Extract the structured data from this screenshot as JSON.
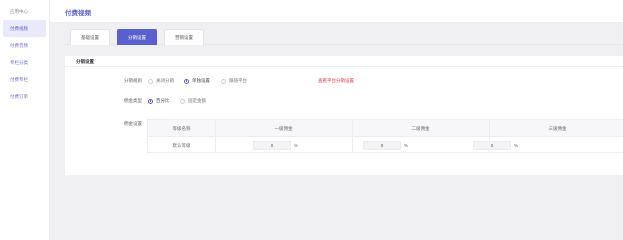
{
  "sidebar": {
    "items": [
      {
        "label": "应用中心",
        "active": false
      },
      {
        "label": "付费视频",
        "active": true
      },
      {
        "label": "付费音频",
        "active": false
      },
      {
        "label": "专栏分类",
        "active": false
      },
      {
        "label": "付费专栏",
        "active": false
      },
      {
        "label": "付费订单",
        "active": false
      }
    ]
  },
  "header": {
    "title": "付费视频"
  },
  "tabs": [
    {
      "label": "基础设置",
      "active": false
    },
    {
      "label": "分销设置",
      "active": true
    },
    {
      "label": "营销设置",
      "active": false
    }
  ],
  "section": {
    "title": "分销设置"
  },
  "distribution_rule": {
    "label": "分销规则",
    "options": [
      "关闭分销",
      "单独设置",
      "跟随平台"
    ],
    "selected": "单独设置",
    "help_link": "查看平台分销设置"
  },
  "commission_type": {
    "label": "佣金类型",
    "options": [
      "百分比",
      "固定金额"
    ],
    "selected": "百分比"
  },
  "commission_settings": {
    "label": "佣金设置",
    "headers": [
      "等级名称",
      "一级佣金",
      "二级佣金",
      "三级佣金"
    ],
    "rows": [
      {
        "level": "默认等级",
        "values": [
          "0",
          "0",
          "0"
        ],
        "unit": "%"
      }
    ]
  },
  "colors": {
    "accent": "#5a5fd0",
    "link_red": "#e8383d",
    "background": "#f0f0f3"
  }
}
